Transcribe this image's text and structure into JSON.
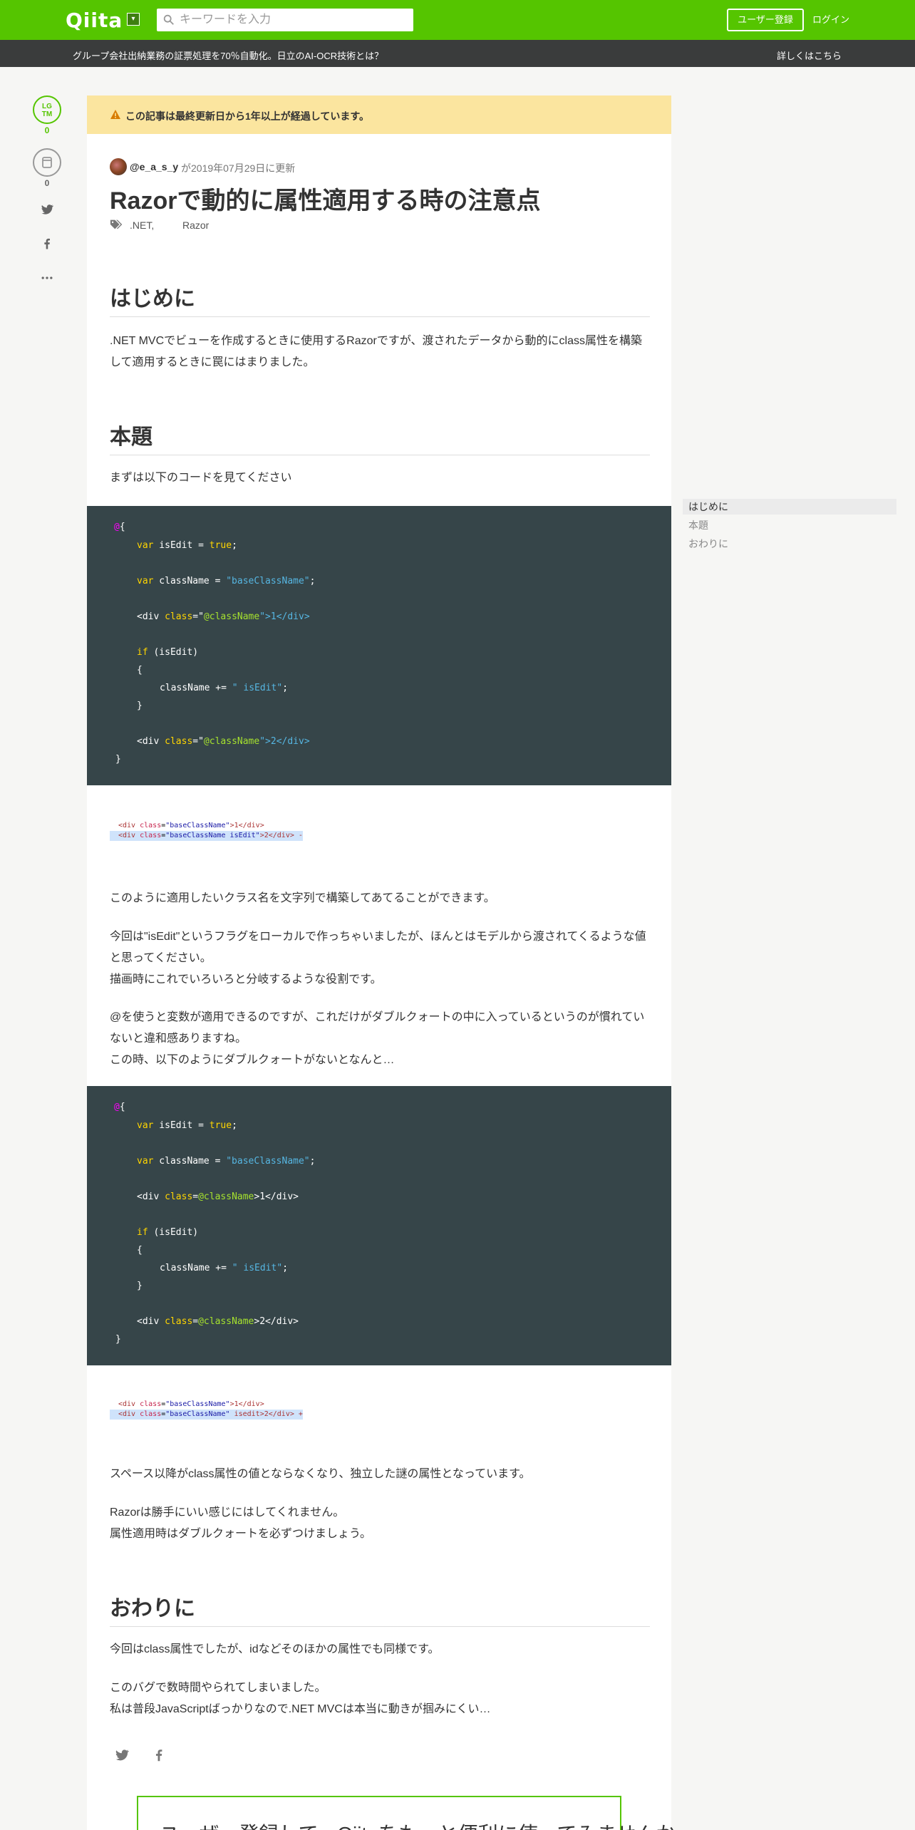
{
  "header": {
    "logo": "Qiita",
    "search_placeholder": "キーワードを入力",
    "signup_label": "ユーザー登録",
    "login_label": "ログイン"
  },
  "announcement": {
    "message": "グループ会社出納業務の証票処理を70％自動化。日立のAI-OCR技術とは？",
    "more_link": "詳しくはこちら"
  },
  "rail": {
    "lgtm_label_1": "LG",
    "lgtm_label_2": "TM",
    "lgtm_count": "0",
    "stock_count": "0"
  },
  "article": {
    "alert": "この記事は最終更新日から1年以上が経過しています。",
    "user": "@e_a_s_y",
    "updated": "が2019年07月29日に更新",
    "title": "Razorで動的に属性適用する時の注意点",
    "tags": [
      ".NET,",
      "Razor"
    ],
    "sections": {
      "intro_heading": "はじめに",
      "intro_p": ".NET MVCでビューを作成するときに使用するRazorですが、渡されたデータから動的にclass属性を構築して適用するときに罠にはまりました。",
      "main_heading": "本題",
      "main_p1": "まずは以下のコードを見てください",
      "main_p2": "このように適用したいクラス名を文字列で構築してあてることができます。",
      "main_p3a": "今回は\"isEdit\"というフラグをローカルで作っちゃいましたが、ほんとはモデルから渡されてくるような値と思ってください。",
      "main_p3b": "描画時にこれでいろいろと分岐するような役割です。",
      "main_p4a": "@を使うと変数が適用できるのですが、これだけがダブルクォートの中に入っているというのが慣れていないと違和感ありますね。",
      "main_p4b": "この時、以下のようにダブルクォートがないとなんと…",
      "main_p5": "スペース以降がclass属性の値とならなくなり、独立した謎の属性となっています。",
      "main_p6a": "Razorは勝手にいい感じにはしてくれません。",
      "main_p6b": "属性適用時はダブルクォートを必ずつけましょう。",
      "end_heading": "おわりに",
      "end_p1": "今回はclass属性でしたが、idなどそのほかの属性でも同様です。",
      "end_p2a": "このバグで数時間やられてしまいました。",
      "end_p2b": "私は普段JavaScriptばっかりなので.NET MVCは本当に動きが掴みにくい…"
    },
    "code1": {
      "l1a": "@",
      "l1b": "{",
      "l2_kw": "var",
      "l2_var": " isEdit = ",
      "l2_val": "true",
      "l2_end": ";",
      "l3_kw": "var",
      "l3_var": " className = ",
      "l3_val": "\"baseClassName\"",
      "l3_end": ";",
      "l4_open": "<div ",
      "l4_attr": "class",
      "l4_eq": "=\"",
      "l4_at": "@className",
      "l4_close": "\">1</div>",
      "l5_kw": "if",
      "l5_rest": " (isEdit)",
      "l6": "{",
      "l7_var": "className += ",
      "l7_val": "\" isEdit\"",
      "l7_end": ";",
      "l8": "}",
      "l9_open": "<div ",
      "l9_attr": "class",
      "l9_eq": "=\"",
      "l9_at": "@className",
      "l9_close": "\">2</div>",
      "l10": "}"
    },
    "code2": {
      "l1a": "@",
      "l1b": "{",
      "l2_kw": "var",
      "l2_var": " isEdit = ",
      "l2_val": "true",
      "l2_end": ";",
      "l3_kw": "var",
      "l3_var": " className = ",
      "l3_val": "\"baseClassName\"",
      "l3_end": ";",
      "l4_open": "<div ",
      "l4_attr": "class",
      "l4_eq": "=",
      "l4_at": "@className",
      "l4_close": ">1</div>",
      "l5_kw": "if",
      "l5_rest": " (isEdit)",
      "l6": "{",
      "l7_var": "className += ",
      "l7_val": "\" isEdit\"",
      "l7_end": ";",
      "l8": "}",
      "l9_open": "<div ",
      "l9_attr": "class",
      "l9_eq": "=",
      "l9_at": "@className",
      "l9_close": ">2</div>",
      "l10": "}"
    },
    "snippet1": {
      "a_open": "<div ",
      "a_attr": "class",
      "a_eq": "=",
      "a_val": "\"baseClassName\"",
      "a_txt": ">1</div>",
      "b_open": "<div ",
      "b_attr": "class",
      "b_eq": "=",
      "b_val": "\"baseClassName isEdit\"",
      "b_txt": ">2</div> -"
    },
    "snippet2": {
      "a_open": "<div ",
      "a_attr": "class",
      "a_eq": "=",
      "a_val": "\"baseClassName\"",
      "a_txt": ">1</div>",
      "b_open": "<div ",
      "b_attr": "class",
      "b_eq": "=",
      "b_val": "\"baseClassName\"",
      "b_txt": " isedit>2</div> +"
    },
    "cta": "ユーザー登録して、Qiitaをもっと便利に使ってみませんか。"
  },
  "toc": {
    "items": [
      "はじめに",
      "本題",
      "おわりに"
    ]
  },
  "colors": {
    "brand": "#55c500",
    "code_bg": "#364549",
    "alert_bg": "#fbe59f"
  }
}
